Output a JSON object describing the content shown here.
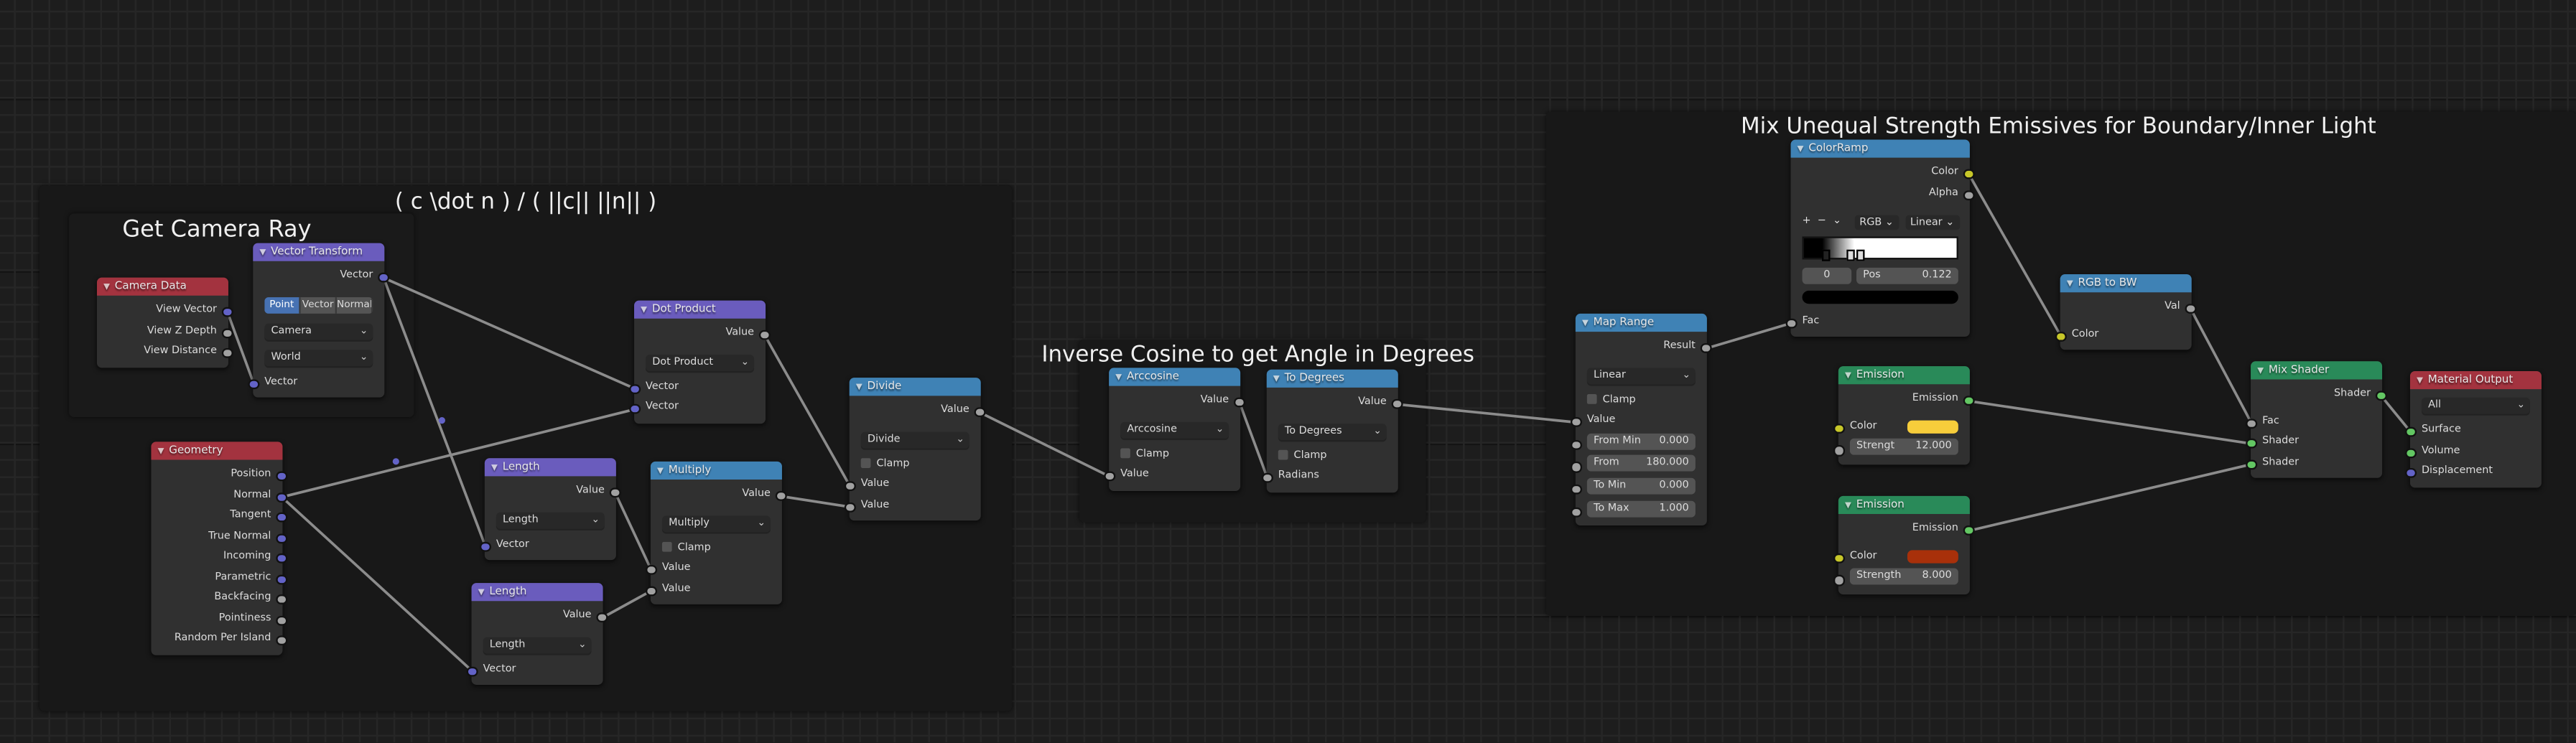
{
  "colors": {
    "input": "#a3333f",
    "vector": "#6a5cbd",
    "converter": "#3f82b5",
    "shader": "#298a59",
    "output": "#a3333f",
    "socket_float": "#a1a1a1",
    "socket_vector": "#6363c7",
    "socket_color": "#c7c729",
    "socket_shader": "#63c763"
  },
  "frames": [
    {
      "id": "f_formula",
      "label": "( c \\dot n ) / ( ||c|| ||n|| )"
    },
    {
      "id": "f_camera",
      "label": "Get Camera Ray"
    },
    {
      "id": "f_acos",
      "label": "Inverse Cosine to get Angle in Degrees"
    },
    {
      "id": "f_mix",
      "label": "Mix Unequal Strength Emissives for Boundary/Inner Light"
    }
  ],
  "nodes": [
    {
      "id": "camera_data",
      "title": "Camera Data",
      "kind": "input",
      "rows": [
        {
          "t": "out",
          "label": "View Vector",
          "s": "vector"
        },
        {
          "t": "out",
          "label": "View Z Depth",
          "s": "float"
        },
        {
          "t": "out",
          "label": "View Distance",
          "s": "float"
        }
      ]
    },
    {
      "id": "vector_transform",
      "title": "Vector Transform",
      "kind": "vector",
      "rows": [
        {
          "t": "out",
          "label": "Vector",
          "s": "vector"
        },
        {
          "t": "buttons",
          "options": [
            "Point",
            "Vector",
            "Normal"
          ],
          "active": 0
        },
        {
          "t": "dropdown",
          "value": "Camera"
        },
        {
          "t": "dropdown",
          "value": "World"
        },
        {
          "t": "in",
          "label": "Vector",
          "s": "vector"
        }
      ]
    },
    {
      "id": "geometry",
      "title": "Geometry",
      "kind": "input",
      "rows": [
        {
          "t": "out",
          "label": "Position",
          "s": "vector"
        },
        {
          "t": "out",
          "label": "Normal",
          "s": "vector"
        },
        {
          "t": "out",
          "label": "Tangent",
          "s": "vector"
        },
        {
          "t": "out",
          "label": "True Normal",
          "s": "vector"
        },
        {
          "t": "out",
          "label": "Incoming",
          "s": "vector"
        },
        {
          "t": "out",
          "label": "Parametric",
          "s": "vector"
        },
        {
          "t": "out",
          "label": "Backfacing",
          "s": "float"
        },
        {
          "t": "out",
          "label": "Pointiness",
          "s": "float"
        },
        {
          "t": "out",
          "label": "Random Per Island",
          "s": "float"
        }
      ]
    },
    {
      "id": "dot_product",
      "title": "Dot Product",
      "kind": "vector",
      "rows": [
        {
          "t": "out",
          "label": "Value",
          "s": "float"
        },
        {
          "t": "dropdown",
          "value": "Dot Product"
        },
        {
          "t": "in",
          "label": "Vector",
          "s": "vector"
        },
        {
          "t": "in",
          "label": "Vector",
          "s": "vector"
        }
      ]
    },
    {
      "id": "length_1",
      "title": "Length",
      "kind": "vector",
      "rows": [
        {
          "t": "out",
          "label": "Value",
          "s": "float"
        },
        {
          "t": "dropdown",
          "value": "Length"
        },
        {
          "t": "in",
          "label": "Vector",
          "s": "vector"
        }
      ]
    },
    {
      "id": "length_2",
      "title": "Length",
      "kind": "vector",
      "rows": [
        {
          "t": "out",
          "label": "Value",
          "s": "float"
        },
        {
          "t": "dropdown",
          "value": "Length"
        },
        {
          "t": "in",
          "label": "Vector",
          "s": "vector"
        }
      ]
    },
    {
      "id": "multiply",
      "title": "Multiply",
      "kind": "converter",
      "rows": [
        {
          "t": "out",
          "label": "Value",
          "s": "float"
        },
        {
          "t": "dropdown",
          "value": "Multiply"
        },
        {
          "t": "check",
          "label": "Clamp"
        },
        {
          "t": "in",
          "label": "Value",
          "s": "float"
        },
        {
          "t": "in",
          "label": "Value",
          "s": "float"
        }
      ]
    },
    {
      "id": "divide",
      "title": "Divide",
      "kind": "converter",
      "rows": [
        {
          "t": "out",
          "label": "Value",
          "s": "float"
        },
        {
          "t": "dropdown",
          "value": "Divide"
        },
        {
          "t": "check",
          "label": "Clamp"
        },
        {
          "t": "in",
          "label": "Value",
          "s": "float"
        },
        {
          "t": "in",
          "label": "Value",
          "s": "float"
        }
      ]
    },
    {
      "id": "arccosine",
      "title": "Arccosine",
      "kind": "converter",
      "rows": [
        {
          "t": "out",
          "label": "Value",
          "s": "float"
        },
        {
          "t": "dropdown",
          "value": "Arccosine"
        },
        {
          "t": "check",
          "label": "Clamp"
        },
        {
          "t": "in",
          "label": "Value",
          "s": "float"
        }
      ]
    },
    {
      "id": "to_degrees",
      "title": "To Degrees",
      "kind": "converter",
      "rows": [
        {
          "t": "out",
          "label": "Value",
          "s": "float"
        },
        {
          "t": "dropdown",
          "value": "To Degrees"
        },
        {
          "t": "check",
          "label": "Clamp"
        },
        {
          "t": "in",
          "label": "Radians",
          "s": "float"
        }
      ]
    },
    {
      "id": "map_range",
      "title": "Map Range",
      "kind": "converter",
      "rows": [
        {
          "t": "out",
          "label": "Result",
          "s": "float"
        },
        {
          "t": "dropdown",
          "value": "Linear"
        },
        {
          "t": "check",
          "label": "Clamp"
        },
        {
          "t": "in",
          "label": "Value",
          "s": "float"
        },
        {
          "t": "field",
          "label": "From Min",
          "value": "0.000",
          "s": "float"
        },
        {
          "t": "field",
          "label": "From",
          "value": "180.000",
          "s": "float"
        },
        {
          "t": "field",
          "label": "To Min",
          "value": "0.000",
          "s": "float"
        },
        {
          "t": "field",
          "label": "To Max",
          "value": "1.000",
          "s": "float"
        }
      ]
    },
    {
      "id": "color_ramp",
      "title": "ColorRamp",
      "kind": "converter",
      "rows": [
        {
          "t": "out",
          "label": "Color",
          "s": "color"
        },
        {
          "t": "out",
          "label": "Alpha",
          "s": "float"
        },
        {
          "t": "ramptools",
          "add": "+",
          "remove": "−",
          "menu": "⌄",
          "mode": "RGB",
          "interp": "Linear"
        },
        {
          "t": "ramp",
          "stops": [
            0.122,
            0.28,
            0.34
          ]
        },
        {
          "t": "pos",
          "index": "0",
          "label": "Pos",
          "value": "0.122"
        },
        {
          "t": "colorbar",
          "color": "#000000"
        },
        {
          "t": "in",
          "label": "Fac",
          "s": "float"
        }
      ]
    },
    {
      "id": "rgb_to_bw",
      "title": "RGB to BW",
      "kind": "converter",
      "rows": [
        {
          "t": "out",
          "label": "Val",
          "s": "float"
        },
        {
          "t": "in",
          "label": "Color",
          "s": "color"
        }
      ]
    },
    {
      "id": "emission_1",
      "title": "Emission",
      "kind": "shader",
      "rows": [
        {
          "t": "out",
          "label": "Emission",
          "s": "shader"
        },
        {
          "t": "colorfield",
          "label": "Color",
          "color": "#f7cd3b",
          "s": "color"
        },
        {
          "t": "field",
          "label": "Strengt",
          "value": "12.000",
          "s": "float"
        }
      ]
    },
    {
      "id": "emission_2",
      "title": "Emission",
      "kind": "shader",
      "rows": [
        {
          "t": "out",
          "label": "Emission",
          "s": "shader"
        },
        {
          "t": "colorfield",
          "label": "Color",
          "color": "#a8300a",
          "s": "color"
        },
        {
          "t": "field",
          "label": "Strength",
          "value": "8.000",
          "s": "float"
        }
      ]
    },
    {
      "id": "mix_shader",
      "title": "Mix Shader",
      "kind": "shader",
      "rows": [
        {
          "t": "out",
          "label": "Shader",
          "s": "shader"
        },
        {
          "t": "in",
          "label": "Fac",
          "s": "float"
        },
        {
          "t": "in",
          "label": "Shader",
          "s": "shader"
        },
        {
          "t": "in",
          "label": "Shader",
          "s": "shader"
        }
      ]
    },
    {
      "id": "material_output",
      "title": "Material Output",
      "kind": "output",
      "rows": [
        {
          "t": "dropdown",
          "value": "All"
        },
        {
          "t": "in",
          "label": "Surface",
          "s": "shader"
        },
        {
          "t": "in",
          "label": "Volume",
          "s": "shader"
        },
        {
          "t": "in",
          "label": "Displacement",
          "s": "vector"
        }
      ]
    }
  ],
  "links": [
    [
      "camera_data",
      0,
      "vector_transform",
      4
    ],
    [
      "vector_transform",
      0,
      "dot_product",
      2
    ],
    [
      "vector_transform",
      0,
      "length_1",
      2
    ],
    [
      "geometry",
      1,
      "dot_product",
      3
    ],
    [
      "geometry",
      1,
      "length_2",
      2
    ],
    [
      "dot_product",
      0,
      "divide",
      3
    ],
    [
      "length_1",
      0,
      "multiply",
      3
    ],
    [
      "length_2",
      0,
      "multiply",
      4
    ],
    [
      "multiply",
      0,
      "divide",
      4
    ],
    [
      "divide",
      0,
      "arccosine",
      3
    ],
    [
      "arccosine",
      0,
      "to_degrees",
      3
    ],
    [
      "to_degrees",
      0,
      "map_range",
      3
    ],
    [
      "map_range",
      0,
      "color_ramp",
      6
    ],
    [
      "color_ramp",
      0,
      "rgb_to_bw",
      1
    ],
    [
      "rgb_to_bw",
      0,
      "mix_shader",
      1
    ],
    [
      "emission_1",
      0,
      "mix_shader",
      2
    ],
    [
      "emission_2",
      0,
      "mix_shader",
      3
    ],
    [
      "mix_shader",
      0,
      "material_output",
      1
    ]
  ]
}
